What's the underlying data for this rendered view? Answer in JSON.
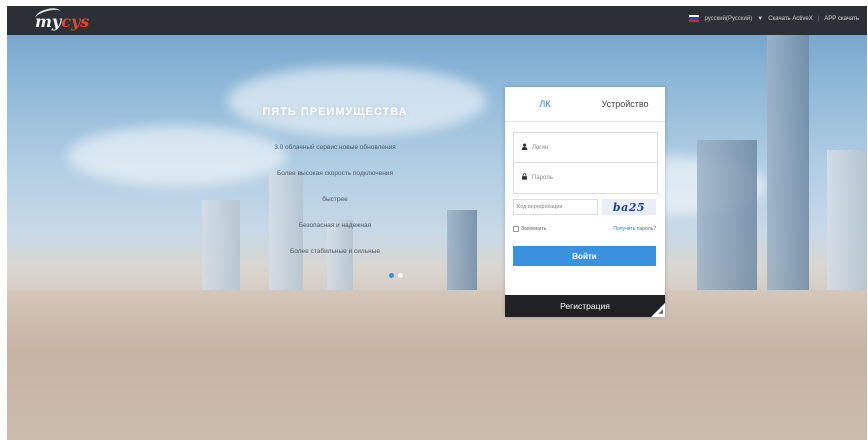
{
  "header": {
    "logo_text_main": "my",
    "logo_text_accent": "cys",
    "language": "русский(Русский)",
    "language_caret": "▼",
    "activex_link": "Скачать ActiveX",
    "separator": "|",
    "app_link": "APP скачать",
    "colors": {
      "bar": "#2c2f35",
      "accent": "#e0462a"
    }
  },
  "features": {
    "title": "ПЯТЬ ПРЕИМУЩЕСТВА",
    "items": [
      "3.0 облачный сервис новые обновления",
      "Более высокая скорость подключения",
      "быстрее",
      "Безопасная и надежная",
      "Более стабильные и сильные"
    ],
    "carousel": {
      "count": 2,
      "active": 1
    }
  },
  "login": {
    "tabs": [
      "ЛК",
      "Устройство"
    ],
    "active_tab": 0,
    "login_placeholder": "Логин",
    "password_placeholder": "Пароль",
    "captcha_placeholder": "Код верификации",
    "captcha_text": "ba25",
    "remember_label": "Запомнить",
    "forgot_link": "Получить пароль?",
    "login_button": "Войти",
    "register_button": "Регистрация",
    "accent_color": "#3a92de"
  }
}
